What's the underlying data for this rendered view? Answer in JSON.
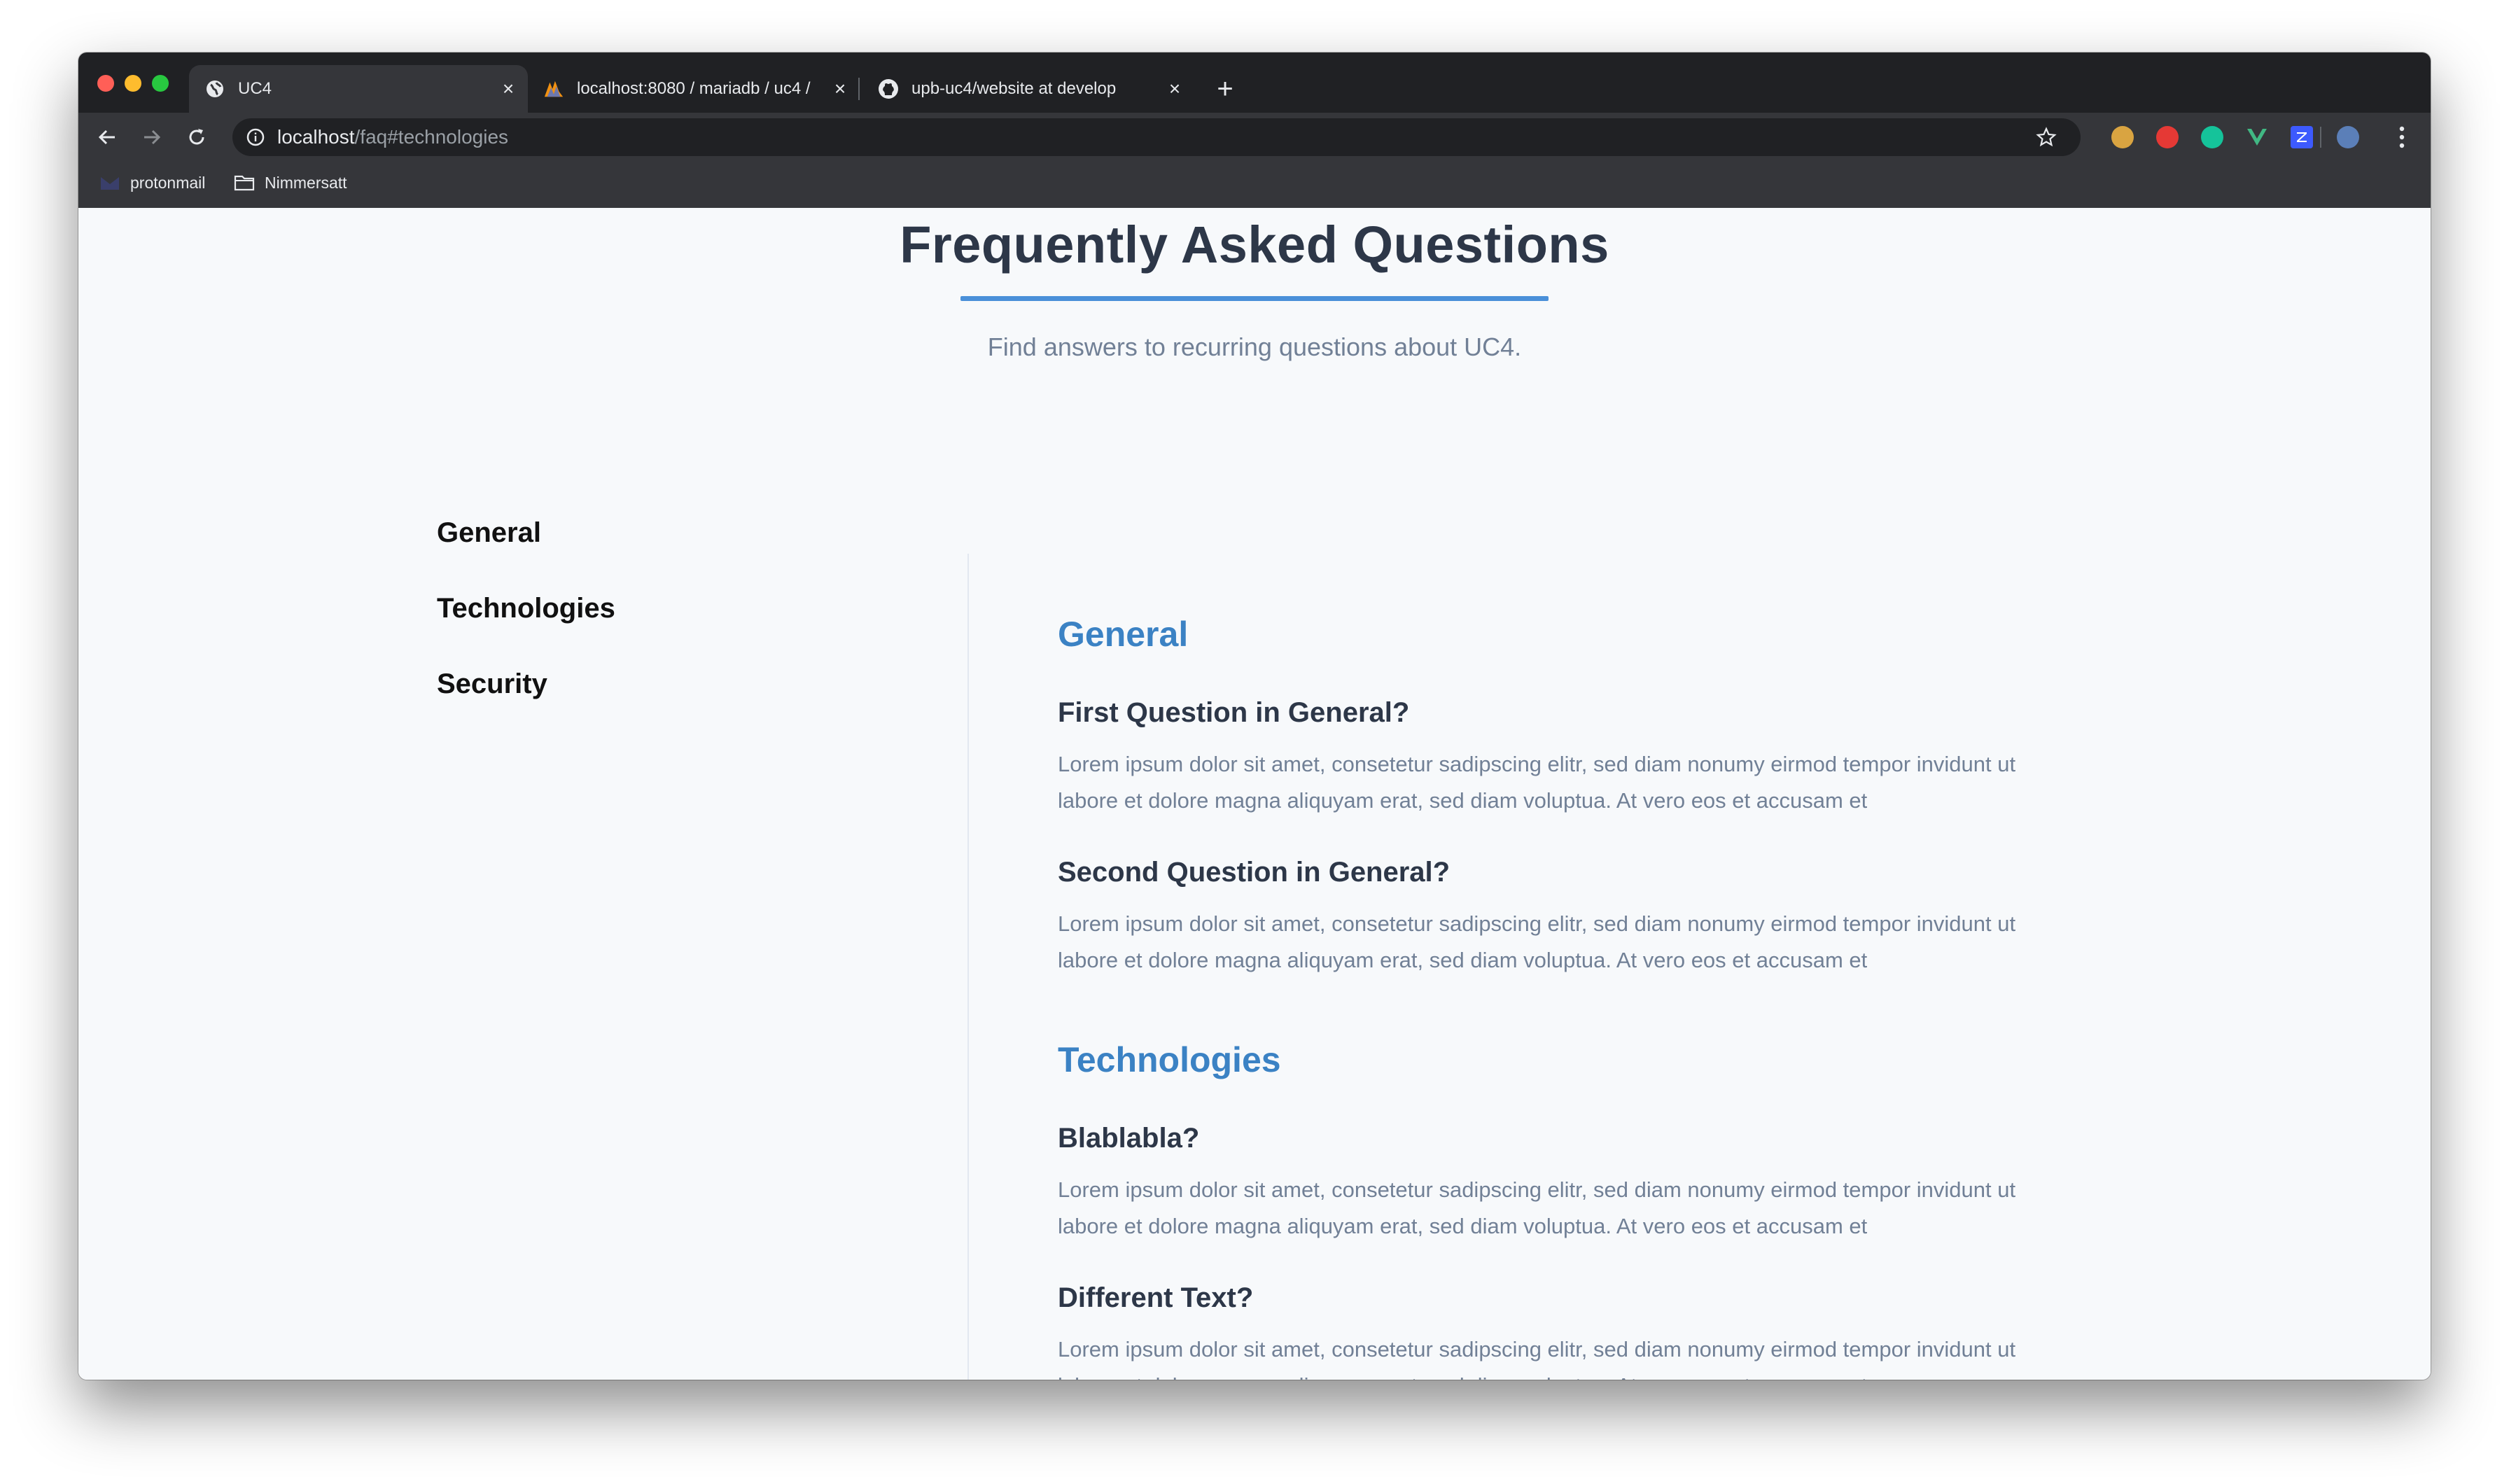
{
  "browser": {
    "tabs": [
      {
        "title": "UC4",
        "icon": "globe-icon",
        "active": true
      },
      {
        "title": "localhost:8080 / mariadb / uc4 /",
        "icon": "phpmyadmin-icon",
        "active": false
      },
      {
        "title": "upb-uc4/website at develop",
        "icon": "github-icon",
        "active": false
      }
    ],
    "new_tab": "+",
    "close_glyph": "×",
    "url_host": "localhost",
    "url_path": "/faq#technologies",
    "bookmarks": [
      {
        "label": "protonmail",
        "icon": "protonmail-icon"
      },
      {
        "label": "Nimmersatt",
        "icon": "folder-icon"
      }
    ],
    "extensions": [
      {
        "name": "cookie-icon",
        "color": "#d9a441"
      },
      {
        "name": "adblock-icon",
        "color": "#e53935"
      },
      {
        "name": "grammarly-icon",
        "color": "#15c39a"
      },
      {
        "name": "vue-devtools-icon",
        "color": "#41b883"
      },
      {
        "name": "z-extension-icon",
        "color": "#3d5afe"
      },
      {
        "name": "profile-avatar-icon",
        "color": "#5b7fb8"
      }
    ]
  },
  "faq": {
    "title": "Frequently Asked Questions",
    "subtitle": "Find answers to recurring questions about UC4.",
    "nav": [
      "General",
      "Technologies",
      "Security"
    ],
    "sections": [
      {
        "title": "General",
        "questions": [
          {
            "q": "First Question in General?",
            "a": "Lorem ipsum dolor sit amet, consetetur sadipscing elitr, sed diam nonumy eirmod tempor invidunt ut labore et dolore magna aliquyam erat, sed diam voluptua. At vero eos et accusam et"
          },
          {
            "q": "Second Question in General?",
            "a": "Lorem ipsum dolor sit amet, consetetur sadipscing elitr, sed diam nonumy eirmod tempor invidunt ut labore et dolore magna aliquyam erat, sed diam voluptua. At vero eos et accusam et"
          }
        ]
      },
      {
        "title": "Technologies",
        "questions": [
          {
            "q": "Blablabla?",
            "a": "Lorem ipsum dolor sit amet, consetetur sadipscing elitr, sed diam nonumy eirmod tempor invidunt ut labore et dolore magna aliquyam erat, sed diam voluptua. At vero eos et accusam et"
          },
          {
            "q": "Different Text?",
            "a": "Lorem ipsum dolor sit amet, consetetur sadipscing elitr, sed diam nonumy eirmod tempor invidunt ut labore et dolore magna aliquyam erat, sed diam voluptua. At vero eos et accusam et"
          }
        ]
      }
    ]
  }
}
